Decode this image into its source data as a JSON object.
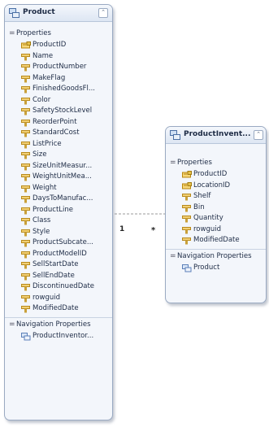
{
  "product": {
    "title": "Product",
    "properties_label": "Properties",
    "properties": [
      {
        "name": "ProductID",
        "key": true
      },
      {
        "name": "Name",
        "key": false
      },
      {
        "name": "ProductNumber",
        "key": false
      },
      {
        "name": "MakeFlag",
        "key": false
      },
      {
        "name": "FinishedGoodsFl...",
        "key": false
      },
      {
        "name": "Color",
        "key": false
      },
      {
        "name": "SafetyStockLevel",
        "key": false
      },
      {
        "name": "ReorderPoint",
        "key": false
      },
      {
        "name": "StandardCost",
        "key": false
      },
      {
        "name": "ListPrice",
        "key": false
      },
      {
        "name": "Size",
        "key": false
      },
      {
        "name": "SizeUnitMeasur...",
        "key": false
      },
      {
        "name": "WeightUnitMea...",
        "key": false
      },
      {
        "name": "Weight",
        "key": false
      },
      {
        "name": "DaysToManufac...",
        "key": false
      },
      {
        "name": "ProductLine",
        "key": false
      },
      {
        "name": "Class",
        "key": false
      },
      {
        "name": "Style",
        "key": false
      },
      {
        "name": "ProductSubcate...",
        "key": false
      },
      {
        "name": "ProductModelID",
        "key": false
      },
      {
        "name": "SellStartDate",
        "key": false
      },
      {
        "name": "SellEndDate",
        "key": false
      },
      {
        "name": "DiscontinuedDate",
        "key": false
      },
      {
        "name": "rowguid",
        "key": false
      },
      {
        "name": "ModifiedDate",
        "key": false
      }
    ],
    "nav_label": "Navigation Properties",
    "nav_properties": [
      "ProductInventor..."
    ]
  },
  "inventory": {
    "title": "ProductInvent...",
    "properties_label": "Properties",
    "properties": [
      {
        "name": "ProductID",
        "key": true
      },
      {
        "name": "LocationID",
        "key": true
      },
      {
        "name": "Shelf",
        "key": false
      },
      {
        "name": "Bin",
        "key": false
      },
      {
        "name": "Quantity",
        "key": false
      },
      {
        "name": "rowguid",
        "key": false
      },
      {
        "name": "ModifiedDate",
        "key": false
      }
    ],
    "nav_label": "Navigation Properties",
    "nav_properties": [
      "Product"
    ]
  },
  "association": {
    "end1": "1",
    "end2": "*"
  },
  "colors": {
    "key_icon": "#d9a421",
    "prop_icon": "#e4b54a",
    "nav_icon": "#5a7fb8",
    "border": "#9aaac2"
  }
}
